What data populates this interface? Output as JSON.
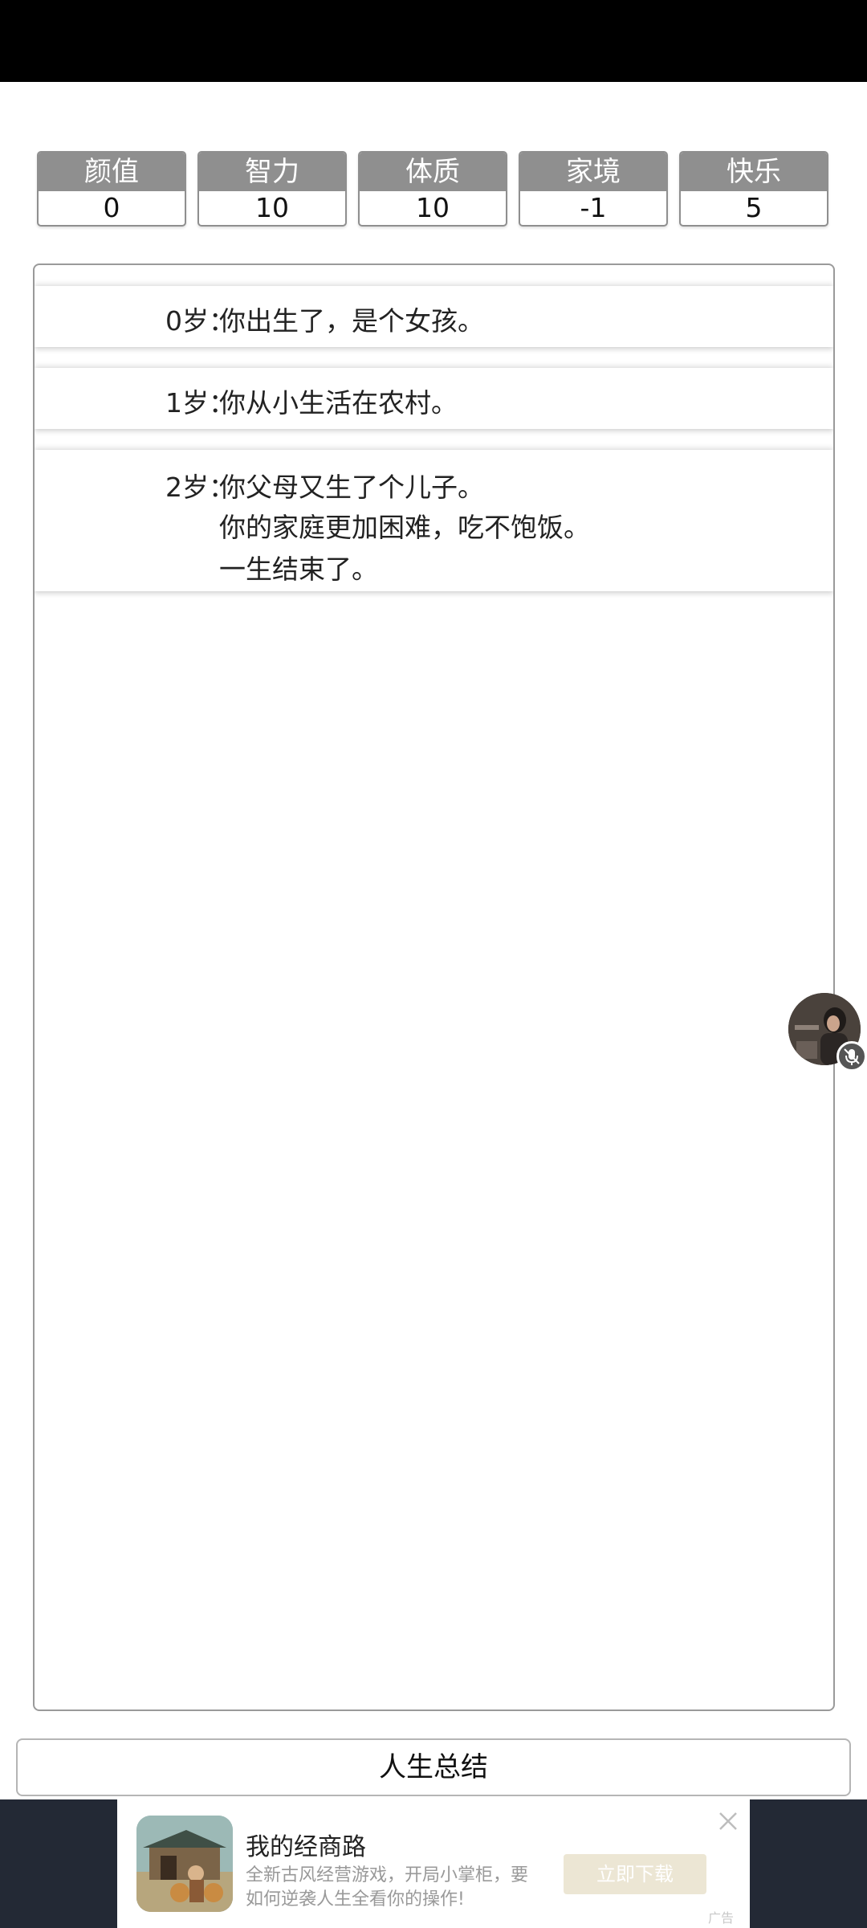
{
  "stats": [
    {
      "label": "颜值",
      "value": "0"
    },
    {
      "label": "智力",
      "value": "10"
    },
    {
      "label": "体质",
      "value": "10"
    },
    {
      "label": "家境",
      "value": "-1"
    },
    {
      "label": "快乐",
      "value": "5"
    }
  ],
  "log": [
    {
      "age": "0岁：",
      "lines": [
        "你出生了，是个女孩。"
      ]
    },
    {
      "age": "1岁：",
      "lines": [
        "你从小生活在农村。"
      ]
    },
    {
      "age": "2岁：",
      "lines": [
        "你父母又生了个儿子。",
        "你的家庭更加困难，吃不饱饭。",
        "一生结束了。"
      ]
    }
  ],
  "summary_button": "人生总结",
  "ad": {
    "title": "我的经商路",
    "description_line1": "全新古风经营游戏，开局小掌柜，要",
    "description_line2": "如何逆袭人生全看你的操作!",
    "download_label": "立即下载",
    "tag": "广告"
  },
  "colors": {
    "stat_header": "#8f8f8f",
    "status_bar": "#000000",
    "ad_background": "#232935",
    "download_button": "#ece6d4"
  },
  "icons": [
    "close-icon",
    "mute-icon",
    "app-icon",
    "avatar"
  ]
}
